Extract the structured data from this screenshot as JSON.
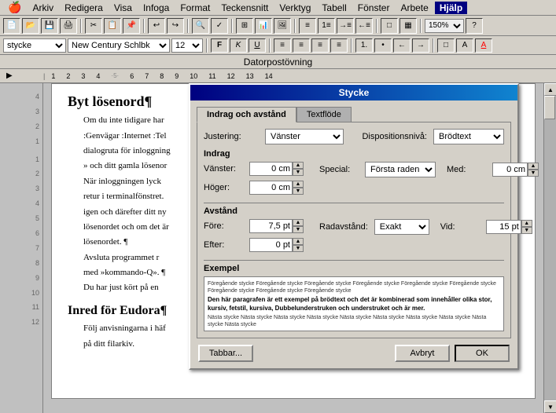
{
  "menubar": {
    "apple": "🍎",
    "items": [
      {
        "label": "Arkiv",
        "active": false
      },
      {
        "label": "Redigera",
        "active": false
      },
      {
        "label": "Visa",
        "active": false
      },
      {
        "label": "Infoga",
        "active": false
      },
      {
        "label": "Format",
        "active": false
      },
      {
        "label": "Teckensnitt",
        "active": false
      },
      {
        "label": "Verktyg",
        "active": false
      },
      {
        "label": "Tabell",
        "active": false
      },
      {
        "label": "Fönster",
        "active": false
      },
      {
        "label": "Arbete",
        "active": false
      },
      {
        "label": "Hjälp",
        "active": true,
        "bold": true
      }
    ]
  },
  "formatbar": {
    "style_value": "stycke",
    "font_value": "New Century Schlbk",
    "size_value": "12",
    "bold_label": "F",
    "italic_label": "K",
    "underline_label": "U"
  },
  "doc_title": "Datorpostövning",
  "zoom_value": "150%",
  "document": {
    "heading1": "Byt lösenord¶",
    "para1": "Om du inte tidigare har",
    "para2": ":Genvägar :Internet :Tel",
    "para3": "dialogruta för inloggning",
    "para4": "» och ditt gamla lösenor",
    "para5": "När inloggningen lyck",
    "para6": "retur i terminalfönstret.",
    "para7": "igen och därefter ditt ny",
    "para8": "lösenordet och om det är",
    "para9": "lösenordet. ¶",
    "para10": "Avsluta programmet r",
    "para11": "med »kommando-Q». ¶",
    "para12": "Du har just kört på en",
    "heading2": "Inred för Eudora¶",
    "para13": "Följ anvisningarna i häf",
    "para14": "på ditt filarkiv."
  },
  "dialog": {
    "title": "Stycke",
    "tabs": [
      {
        "label": "Indrag och avstånd",
        "active": true
      },
      {
        "label": "Textflöde",
        "active": false
      }
    ],
    "justering_label": "Justering:",
    "justering_value": "Vänster",
    "dispositionsniva_label": "Dispositionsnivå:",
    "dispositionsniva_value": "Brödtext",
    "indrag_section": "Indrag",
    "vanster_label": "Vänster:",
    "vanster_value": "0 cm",
    "hoger_label": "Höger:",
    "hoger_value": "0 cm",
    "special_label": "Special:",
    "special_value": "Första raden",
    "med_label": "Med:",
    "med_value": "0 cm",
    "avstand_section": "Avstånd",
    "fore_label": "Före:",
    "fore_value": "7,5 pt",
    "efter_label": "Efter:",
    "efter_value": "0 pt",
    "radavstand_label": "Radavstånd:",
    "radavstand_value": "Exakt",
    "vid_label": "Vid:",
    "vid_value": "15 pt",
    "exempel_section": "Exempel",
    "exempel_preview_line1": "Föregående stycke Föregående stycke Föregående stycke Föregående stycke Föregående stycke Föregående stycke Föregående stycke Föregående stycke Föregående stycke",
    "exempel_preview_bold": "Den här paragrafen är ett exempel på brödtext och det är kombinerad som innehåller olika stor, kursiv, fetstil, kursiva, Dubbelunderstruken och understruket och är mer.",
    "exempel_preview_line2": "Nästa stycke Nästa stycke Nästa stycke Nästa stycke Nästa stycke Nästa stycke Nästa stycke Nästa stycke Nästa stycke Nästa stycke",
    "tabbar_btn": "Tabbar...",
    "avbryt_btn": "Avbryt",
    "ok_btn": "OK"
  },
  "ruler": {
    "marks": [
      "1",
      "2",
      "3",
      "4",
      "5",
      "6",
      "7",
      "8",
      "9",
      "10",
      "11",
      "12",
      "13",
      "14"
    ]
  }
}
